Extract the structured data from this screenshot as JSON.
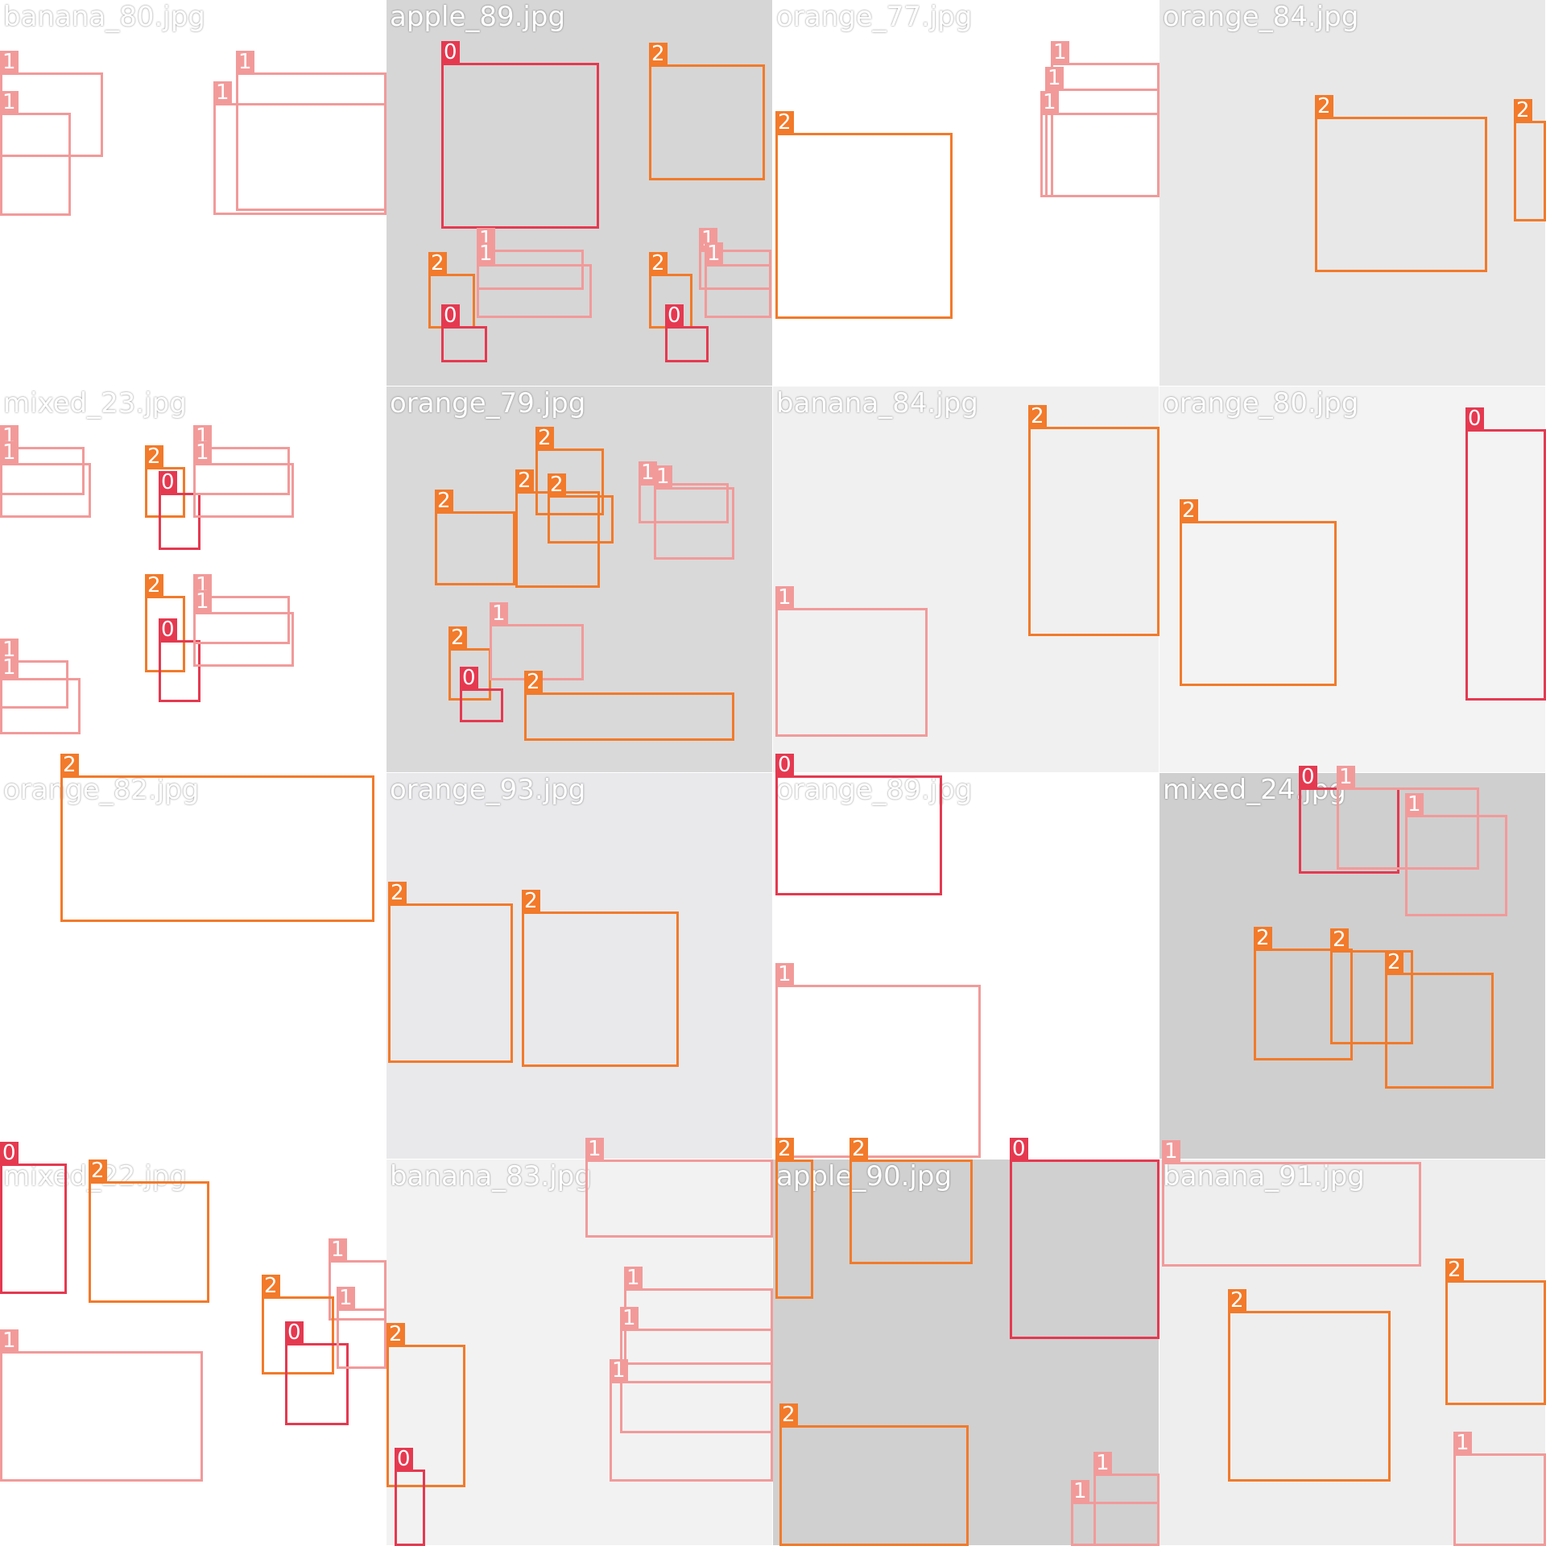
{
  "mosaic": {
    "class_colors": {
      "0": "#e53950",
      "1": "#f29a9a",
      "2": "#f27a2a"
    },
    "tiles": [
      {
        "filename": "banana_80.jpg",
        "background": "#ffffff",
        "boxes": [
          {
            "cls": "1"
          },
          {
            "cls": "1"
          },
          {
            "cls": "1"
          },
          {
            "cls": "1"
          }
        ]
      },
      {
        "filename": "apple_89.jpg",
        "background": "#d6d6d6",
        "boxes": [
          {
            "cls": "0"
          },
          {
            "cls": "2"
          },
          {
            "cls": "2"
          },
          {
            "cls": "0"
          },
          {
            "cls": "1"
          },
          {
            "cls": "1"
          },
          {
            "cls": "2"
          },
          {
            "cls": "0"
          },
          {
            "cls": "1"
          },
          {
            "cls": "1"
          }
        ]
      },
      {
        "filename": "orange_77.jpg",
        "background": "#ffffff",
        "boxes": [
          {
            "cls": "2"
          },
          {
            "cls": "1"
          },
          {
            "cls": "1"
          },
          {
            "cls": "1"
          }
        ]
      },
      {
        "filename": "orange_84.jpg",
        "background": "#e8e8e8",
        "boxes": [
          {
            "cls": "2"
          },
          {
            "cls": "2"
          }
        ]
      },
      {
        "filename": "mixed_23.jpg",
        "background": "#ffffff",
        "boxes": [
          {
            "cls": "1"
          },
          {
            "cls": "1"
          },
          {
            "cls": "2"
          },
          {
            "cls": "0"
          },
          {
            "cls": "1"
          },
          {
            "cls": "1"
          },
          {
            "cls": "2"
          },
          {
            "cls": "0"
          },
          {
            "cls": "1"
          },
          {
            "cls": "1"
          },
          {
            "cls": "1"
          },
          {
            "cls": "1"
          }
        ]
      },
      {
        "filename": "orange_79.jpg",
        "background": "#d9d9d9",
        "boxes": [
          {
            "cls": "2"
          },
          {
            "cls": "2"
          },
          {
            "cls": "2"
          },
          {
            "cls": "2"
          },
          {
            "cls": "1"
          },
          {
            "cls": "1"
          },
          {
            "cls": "2"
          },
          {
            "cls": "0"
          },
          {
            "cls": "1"
          },
          {
            "cls": "2"
          }
        ]
      },
      {
        "filename": "banana_84.jpg",
        "background": "#f0f0f0",
        "boxes": [
          {
            "cls": "1"
          },
          {
            "cls": "2"
          }
        ]
      },
      {
        "filename": "orange_80.jpg",
        "background": "#f3f3f3",
        "boxes": [
          {
            "cls": "2"
          },
          {
            "cls": "0"
          }
        ]
      },
      {
        "filename": "orange_82.jpg",
        "background": "#ffffff",
        "boxes": [
          {
            "cls": "2"
          }
        ]
      },
      {
        "filename": "orange_93.jpg",
        "background": "#e9e9ec",
        "boxes": [
          {
            "cls": "2"
          },
          {
            "cls": "2"
          }
        ]
      },
      {
        "filename": "orange_89.jpg",
        "background": "#ffffff",
        "boxes": [
          {
            "cls": "0"
          },
          {
            "cls": "1"
          }
        ]
      },
      {
        "filename": "mixed_24.jpg",
        "background": "#cfcfcf",
        "boxes": [
          {
            "cls": "0"
          },
          {
            "cls": "1"
          },
          {
            "cls": "1"
          },
          {
            "cls": "2"
          },
          {
            "cls": "2"
          },
          {
            "cls": "2"
          }
        ]
      },
      {
        "filename": "mixed_22.jpg",
        "background": "#ffffff",
        "boxes": [
          {
            "cls": "0"
          },
          {
            "cls": "2"
          },
          {
            "cls": "1"
          },
          {
            "cls": "2"
          },
          {
            "cls": "0"
          },
          {
            "cls": "1"
          },
          {
            "cls": "1"
          },
          {
            "cls": "2"
          },
          {
            "cls": "0"
          }
        ]
      },
      {
        "filename": "banana_83.jpg",
        "background": "#f2f2f2",
        "boxes": [
          {
            "cls": "1"
          },
          {
            "cls": "1"
          },
          {
            "cls": "1"
          },
          {
            "cls": "1"
          }
        ]
      },
      {
        "filename": "apple_90.jpg",
        "background": "#d0d0d0",
        "boxes": [
          {
            "cls": "2"
          },
          {
            "cls": "2"
          },
          {
            "cls": "0"
          },
          {
            "cls": "2"
          },
          {
            "cls": "1"
          },
          {
            "cls": "1"
          }
        ]
      },
      {
        "filename": "banana_91.jpg",
        "background": "#eeeeee",
        "boxes": [
          {
            "cls": "1"
          },
          {
            "cls": "2"
          },
          {
            "cls": "2"
          },
          {
            "cls": "1"
          }
        ]
      }
    ]
  }
}
